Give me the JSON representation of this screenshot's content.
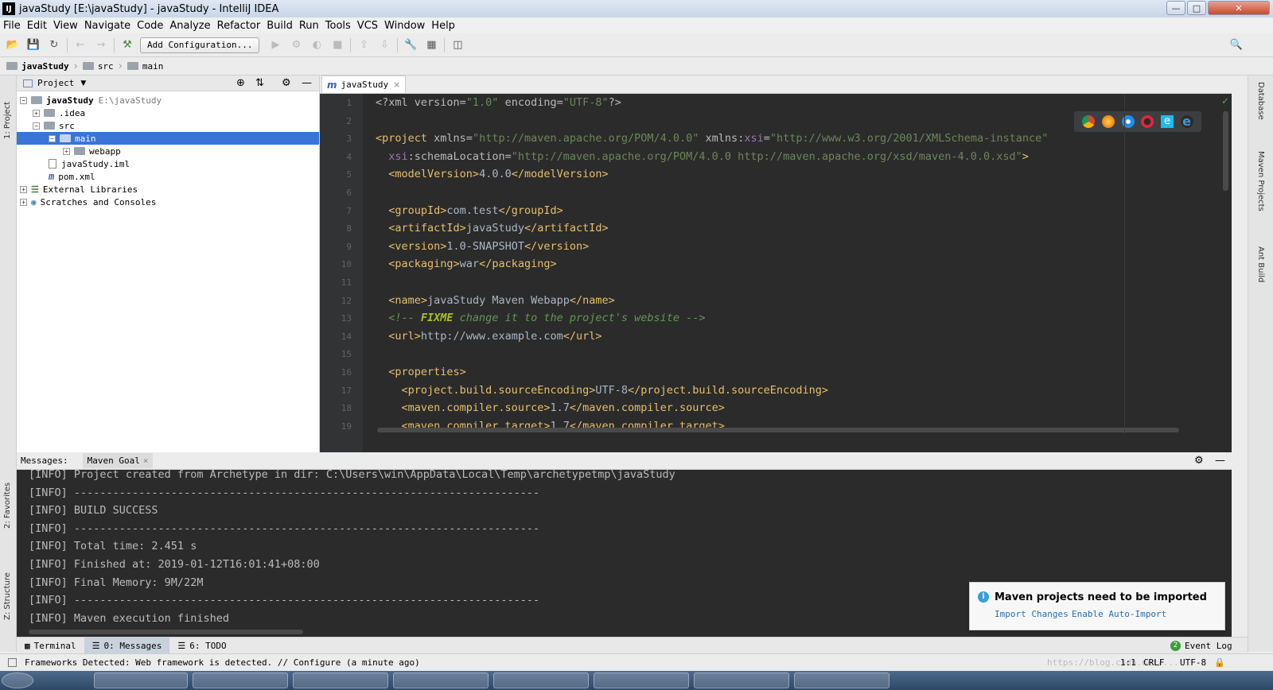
{
  "window": {
    "title": "javaStudy [E:\\javaStudy] - javaStudy - IntelliJ IDEA",
    "app_icon": "IJ"
  },
  "menu": [
    "File",
    "Edit",
    "View",
    "Navigate",
    "Code",
    "Analyze",
    "Refactor",
    "Build",
    "Run",
    "Tools",
    "VCS",
    "Window",
    "Help"
  ],
  "toolbar": {
    "add_configuration": "Add Configuration..."
  },
  "breadcrumb": [
    "javaStudy",
    "src",
    "main"
  ],
  "left_stripe": {
    "project": "1: Project",
    "favorites": "2: Favorites",
    "structure": "Z: Structure"
  },
  "right_stripe": {
    "database": "Database",
    "maven": "Maven Projects",
    "ant": "Ant Build"
  },
  "project_panel": {
    "title": "Project",
    "tree": [
      {
        "label": "javaStudy",
        "extra": "E:\\javaStudy",
        "bold": true
      },
      {
        "label": ".idea"
      },
      {
        "label": "src"
      },
      {
        "label": "main"
      },
      {
        "label": "webapp"
      },
      {
        "label": "javaStudy.iml"
      },
      {
        "label": "pom.xml"
      },
      {
        "label": "External Libraries"
      },
      {
        "label": "Scratches and Consoles"
      }
    ]
  },
  "editor": {
    "tab": "javaStudy",
    "line_numbers": [
      "1",
      "2",
      "3",
      "4",
      "5",
      "6",
      "7",
      "8",
      "9",
      "10",
      "11",
      "12",
      "13",
      "14",
      "15",
      "16",
      "17",
      "18",
      "19"
    ]
  },
  "messages": {
    "tab_label": "Messages:",
    "tab_goal": "Maven Goal",
    "lines": [
      "[INFO] Project created from Archetype in dir: C:\\Users\\win\\AppData\\Local\\Temp\\archetypetmp\\javaStudy",
      "[INFO] ------------------------------------------------------------------------",
      "[INFO] BUILD SUCCESS",
      "[INFO] ------------------------------------------------------------------------",
      "[INFO] Total time: 2.451 s",
      "[INFO] Finished at: 2019-01-12T16:01:41+08:00",
      "[INFO] Final Memory: 9M/22M",
      "[INFO] ------------------------------------------------------------------------",
      "[INFO] Maven execution finished"
    ]
  },
  "notification": {
    "title": "Maven projects need to be imported",
    "import_changes": "Import Changes",
    "enable_auto_import": "Enable Auto-Import"
  },
  "bottom_tabs": {
    "terminal": "Terminal",
    "messages": "0: Messages",
    "todo": "6: TODO",
    "event_log": "Event Log",
    "event_count": "2"
  },
  "status": {
    "message": "Frameworks Detected: Web framework is detected. // Configure (a minute ago)",
    "position": "1:1",
    "line_sep": "CRLF",
    "encoding": "UTF-8",
    "watermark": "https://blog.csdn.net/..."
  }
}
